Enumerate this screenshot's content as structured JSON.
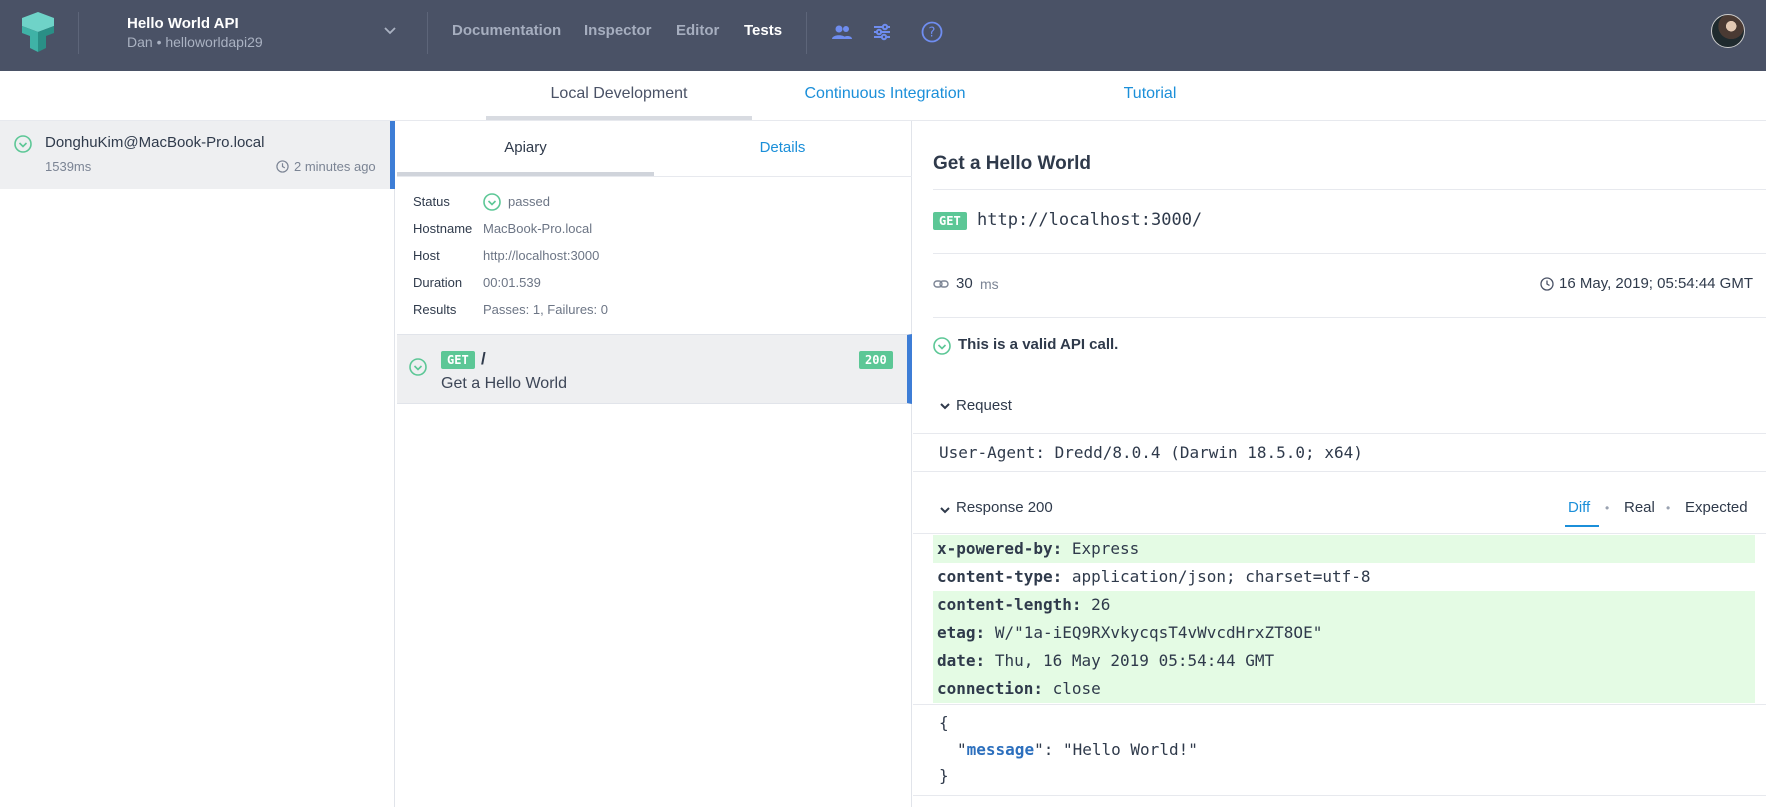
{
  "topbar": {
    "project_title": "Hello World API",
    "project_sub": "Dan • helloworldapi29",
    "nav": [
      "Documentation",
      "Inspector",
      "Editor",
      "Tests"
    ],
    "active_nav": "Tests",
    "icons": [
      "team-icon",
      "settings-sliders-icon",
      "help-icon"
    ]
  },
  "subtabs": {
    "items": [
      "Local Development",
      "Continuous Integration",
      "Tutorial"
    ],
    "active": "Local Development"
  },
  "run": {
    "host": "DonghuKim@MacBook-Pro.local",
    "duration": "1539ms",
    "ago": "2 minutes ago"
  },
  "middle": {
    "tabs": [
      "Apiary",
      "Details"
    ],
    "labels": {
      "status": "Status",
      "hostname": "Hostname",
      "host": "Host",
      "duration": "Duration",
      "results": "Results"
    },
    "values": {
      "status": "passed",
      "hostname": "MacBook-Pro.local",
      "host": "http://localhost:3000",
      "duration": "00:01.539",
      "results": "Passes: 1, Failures: 0"
    },
    "endpoint": {
      "method": "GET",
      "path": "/",
      "name": "Get a Hello World",
      "code": "200"
    }
  },
  "detail": {
    "title": "Get a Hello World",
    "method": "GET",
    "url": "http://localhost:3000/",
    "time_value": "30",
    "time_unit": "ms",
    "date": "16 May, 2019; 05:54:44 GMT",
    "valid_text": "This is a valid API call.",
    "request_label": "Request",
    "user_agent": "User-Agent: Dredd/8.0.4 (Darwin 18.5.0; x64)",
    "response_label": "Response 200",
    "diff_tabs": [
      "Diff",
      "Real",
      "Expected"
    ],
    "diff_dot": "•",
    "headers": [
      {
        "key": "x-powered-by:",
        "value": "Express"
      },
      {
        "key": "content-type:",
        "value": "application/json; charset=utf-8"
      },
      {
        "key": "content-length:",
        "value": "26"
      },
      {
        "key": "etag:",
        "value": "W/\"1a-iEQ9RXvkycqsT4vWvcdHrxZT8OE\""
      },
      {
        "key": "date:",
        "value": "Thu, 16 May 2019 05:54:44 GMT"
      },
      {
        "key": "connection:",
        "value": "close"
      }
    ],
    "body": {
      "open": "{",
      "key_quote_open": "\"",
      "key": "message",
      "key_quote_close": "\":",
      "value": "\"Hello World!\"",
      "close": "}"
    }
  },
  "colors": {
    "topbar": "#4a5266",
    "accent": "#1b8fd9",
    "success": "#5cc796",
    "diff_green": "#e4fbe4",
    "selected_border": "#3d7dd6"
  }
}
